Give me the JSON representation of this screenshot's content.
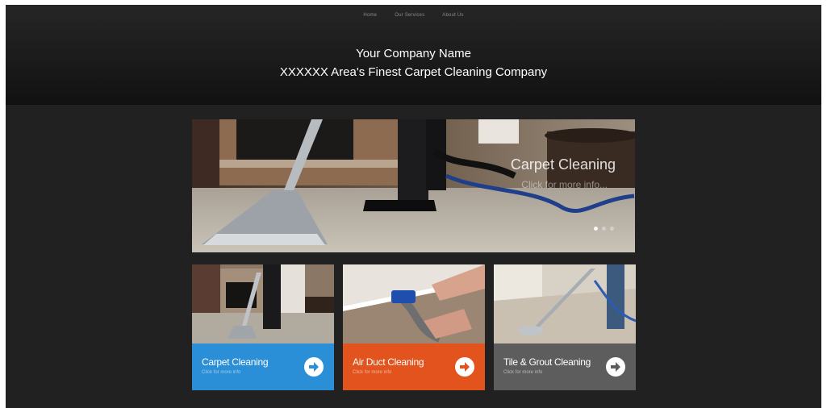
{
  "nav": {
    "items": [
      {
        "label": "Home"
      },
      {
        "label": "Our Services"
      },
      {
        "label": "About Us"
      }
    ]
  },
  "header": {
    "company_name": "Your Company Name",
    "tagline": "XXXXXX Area's Finest Carpet Cleaning Company"
  },
  "hero": {
    "title": "Carpet Cleaning",
    "subtitle": "Click for more info...",
    "slide_count": 3,
    "active_slide": 1
  },
  "cards": [
    {
      "title": "Carpet Cleaning",
      "subtitle": "Click for more info",
      "color": "#2a8fd6",
      "icon": "arrow-right-circle-icon"
    },
    {
      "title": "Air Duct Cleaning",
      "subtitle": "Click for more info",
      "color": "#e2531e",
      "icon": "arrow-right-circle-icon"
    },
    {
      "title": "Tile & Grout Cleaning",
      "subtitle": "Click for more info",
      "color": "#5d5d5d",
      "icon": "arrow-right-circle-icon"
    }
  ]
}
